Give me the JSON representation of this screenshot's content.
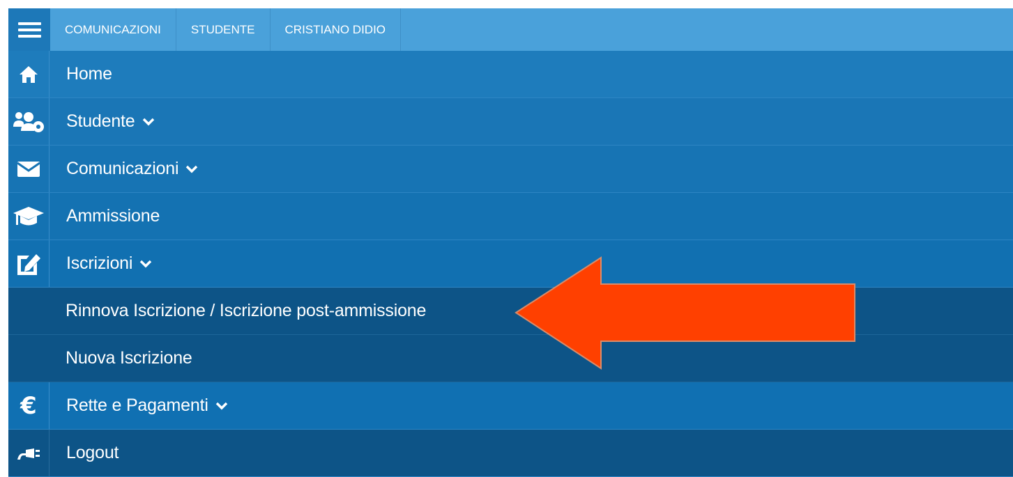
{
  "topbar": {
    "tabs": [
      "COMUNICAZIONI",
      "STUDENTE",
      "CRISTIANO DIDIO"
    ]
  },
  "menu": {
    "home": "Home",
    "studente": "Studente",
    "comunicazioni": "Comunicazioni",
    "ammissione": "Ammissione",
    "iscrizioni": "Iscrizioni",
    "rinnova": "Rinnova Iscrizione / Iscrizione post-ammissione",
    "nuova": "Nuova Iscrizione",
    "rette": "Rette e Pagamenti",
    "logout": "Logout"
  },
  "colors": {
    "topbar": "#4aa1da",
    "menu_item": "#1d79b8",
    "submenu_item": "#0d5487",
    "arrow": "#ff4000"
  },
  "icons": [
    "menu-icon",
    "home-icon",
    "users-gear-icon",
    "envelope-icon",
    "graduation-cap-icon",
    "edit-icon",
    "euro-icon",
    "plug-icon"
  ]
}
